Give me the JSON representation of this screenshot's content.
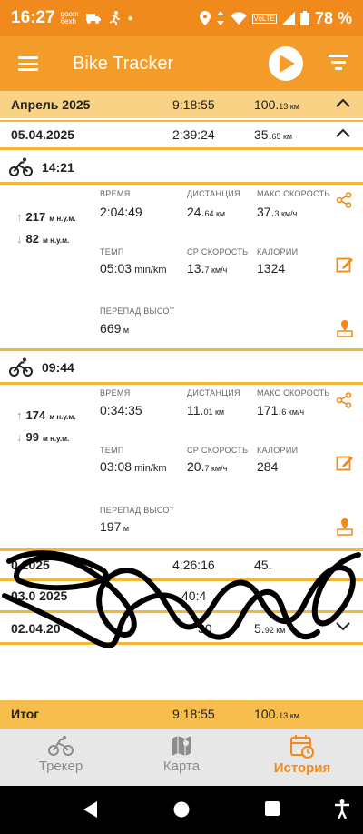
{
  "status_bar": {
    "time": "16:27",
    "carrier_small_top": "goom",
    "carrier_small_bottom": "6exh",
    "lte": "VoLTE",
    "battery_pct": "78 %"
  },
  "app_bar": {
    "title": "Bike Tracker"
  },
  "month": {
    "label": "Апрель 2025",
    "duration": "9:18:55",
    "dist_main": "100.",
    "dist_small": "13 км"
  },
  "day": {
    "label": "05.04.2025",
    "duration": "2:39:24",
    "dist_main": "35.",
    "dist_small": "65 км"
  },
  "rides": [
    {
      "time": "14:21",
      "ascent": "217",
      "ascent_unit": "м н.у.м.",
      "descent": "82",
      "descent_unit": "м н.у.м.",
      "labels": {
        "time": "ВРЕМЯ",
        "distance": "ДИСТАНЦИЯ",
        "max_speed": "МАКС СКОРОСТЬ",
        "pace": "ТЕМП",
        "avg_speed": "СР СКОРОСТЬ",
        "calories": "КАЛОРИИ",
        "elev_diff": "ПЕРЕПАД ВЫСОТ"
      },
      "duration": "2:04:49",
      "dist_main": "24.",
      "dist_small": "64 км",
      "max_main": "37.",
      "max_small": "3 км/ч",
      "pace_main": "05:03",
      "pace_small": " min/km",
      "avg_main": "13.",
      "avg_small": "7 км/ч",
      "calories": "1324",
      "elev_main": "669",
      "elev_small": " м"
    },
    {
      "time": "09:44",
      "ascent": "174",
      "ascent_unit": "м н.у.м.",
      "descent": "99",
      "descent_unit": "м н.у.м.",
      "labels": {
        "time": "ВРЕМЯ",
        "distance": "ДИСТАНЦИЯ",
        "max_speed": "МАКС СКОРОСТЬ",
        "pace": "ТЕМП",
        "avg_speed": "СР СКОРОСТЬ",
        "calories": "КАЛОРИИ",
        "elev_diff": "ПЕРЕПАД ВЫСОТ"
      },
      "duration": "0:34:35",
      "dist_main": "11.",
      "dist_small": "01 км",
      "max_main": "171.",
      "max_small": "6 км/ч",
      "pace_main": "03:08",
      "pace_small": " min/km",
      "avg_main": "20.",
      "avg_small": "7 км/ч",
      "calories": "284",
      "elev_main": "197",
      "elev_small": " м"
    }
  ],
  "other_days": [
    {
      "label": "0 2025",
      "duration": "4:26:16",
      "dist_main": "45.",
      "dist_small": ""
    },
    {
      "label": "03.0 2025",
      "duration": "40:4",
      "dist_main": "",
      "dist_small": ""
    },
    {
      "label": "02.04.20",
      "duration": "30",
      "dist_main": "5.",
      "dist_small": "92 км"
    }
  ],
  "total": {
    "label": "Итог",
    "duration": "9:18:55",
    "dist_main": "100.",
    "dist_small": "13 км"
  },
  "bottom_nav": {
    "tracker": "Трекер",
    "map": "Карта",
    "history": "История"
  },
  "colors": {
    "accent": "#f08a1c",
    "appbar": "#f39c2a",
    "band": "#f4b63a",
    "month_bg": "#f9d286"
  }
}
